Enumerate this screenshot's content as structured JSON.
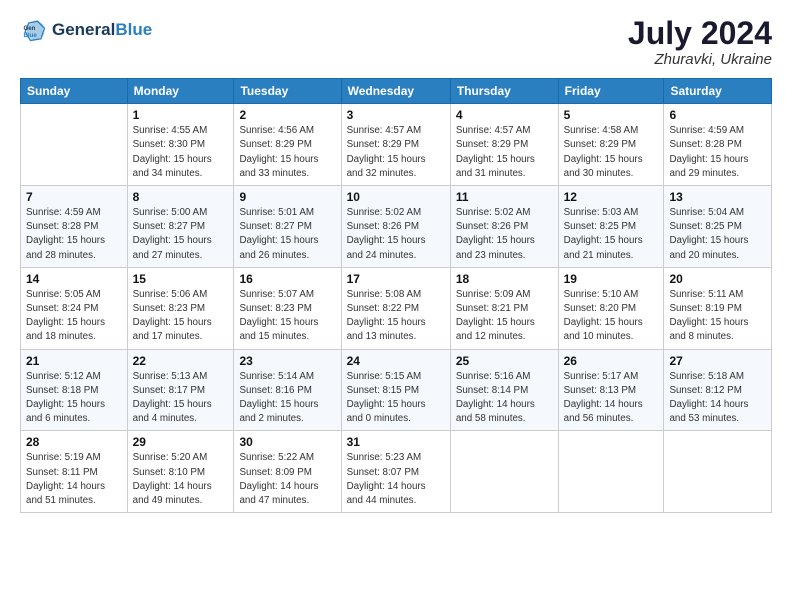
{
  "header": {
    "logo_line1": "General",
    "logo_line2": "Blue",
    "month_year": "July 2024",
    "location": "Zhuravki, Ukraine"
  },
  "days_of_week": [
    "Sunday",
    "Monday",
    "Tuesday",
    "Wednesday",
    "Thursday",
    "Friday",
    "Saturday"
  ],
  "weeks": [
    [
      {
        "day": "",
        "info": ""
      },
      {
        "day": "1",
        "info": "Sunrise: 4:55 AM\nSunset: 8:30 PM\nDaylight: 15 hours\nand 34 minutes."
      },
      {
        "day": "2",
        "info": "Sunrise: 4:56 AM\nSunset: 8:29 PM\nDaylight: 15 hours\nand 33 minutes."
      },
      {
        "day": "3",
        "info": "Sunrise: 4:57 AM\nSunset: 8:29 PM\nDaylight: 15 hours\nand 32 minutes."
      },
      {
        "day": "4",
        "info": "Sunrise: 4:57 AM\nSunset: 8:29 PM\nDaylight: 15 hours\nand 31 minutes."
      },
      {
        "day": "5",
        "info": "Sunrise: 4:58 AM\nSunset: 8:29 PM\nDaylight: 15 hours\nand 30 minutes."
      },
      {
        "day": "6",
        "info": "Sunrise: 4:59 AM\nSunset: 8:28 PM\nDaylight: 15 hours\nand 29 minutes."
      }
    ],
    [
      {
        "day": "7",
        "info": "Sunrise: 4:59 AM\nSunset: 8:28 PM\nDaylight: 15 hours\nand 28 minutes."
      },
      {
        "day": "8",
        "info": "Sunrise: 5:00 AM\nSunset: 8:27 PM\nDaylight: 15 hours\nand 27 minutes."
      },
      {
        "day": "9",
        "info": "Sunrise: 5:01 AM\nSunset: 8:27 PM\nDaylight: 15 hours\nand 26 minutes."
      },
      {
        "day": "10",
        "info": "Sunrise: 5:02 AM\nSunset: 8:26 PM\nDaylight: 15 hours\nand 24 minutes."
      },
      {
        "day": "11",
        "info": "Sunrise: 5:02 AM\nSunset: 8:26 PM\nDaylight: 15 hours\nand 23 minutes."
      },
      {
        "day": "12",
        "info": "Sunrise: 5:03 AM\nSunset: 8:25 PM\nDaylight: 15 hours\nand 21 minutes."
      },
      {
        "day": "13",
        "info": "Sunrise: 5:04 AM\nSunset: 8:25 PM\nDaylight: 15 hours\nand 20 minutes."
      }
    ],
    [
      {
        "day": "14",
        "info": "Sunrise: 5:05 AM\nSunset: 8:24 PM\nDaylight: 15 hours\nand 18 minutes."
      },
      {
        "day": "15",
        "info": "Sunrise: 5:06 AM\nSunset: 8:23 PM\nDaylight: 15 hours\nand 17 minutes."
      },
      {
        "day": "16",
        "info": "Sunrise: 5:07 AM\nSunset: 8:23 PM\nDaylight: 15 hours\nand 15 minutes."
      },
      {
        "day": "17",
        "info": "Sunrise: 5:08 AM\nSunset: 8:22 PM\nDaylight: 15 hours\nand 13 minutes."
      },
      {
        "day": "18",
        "info": "Sunrise: 5:09 AM\nSunset: 8:21 PM\nDaylight: 15 hours\nand 12 minutes."
      },
      {
        "day": "19",
        "info": "Sunrise: 5:10 AM\nSunset: 8:20 PM\nDaylight: 15 hours\nand 10 minutes."
      },
      {
        "day": "20",
        "info": "Sunrise: 5:11 AM\nSunset: 8:19 PM\nDaylight: 15 hours\nand 8 minutes."
      }
    ],
    [
      {
        "day": "21",
        "info": "Sunrise: 5:12 AM\nSunset: 8:18 PM\nDaylight: 15 hours\nand 6 minutes."
      },
      {
        "day": "22",
        "info": "Sunrise: 5:13 AM\nSunset: 8:17 PM\nDaylight: 15 hours\nand 4 minutes."
      },
      {
        "day": "23",
        "info": "Sunrise: 5:14 AM\nSunset: 8:16 PM\nDaylight: 15 hours\nand 2 minutes."
      },
      {
        "day": "24",
        "info": "Sunrise: 5:15 AM\nSunset: 8:15 PM\nDaylight: 15 hours\nand 0 minutes."
      },
      {
        "day": "25",
        "info": "Sunrise: 5:16 AM\nSunset: 8:14 PM\nDaylight: 14 hours\nand 58 minutes."
      },
      {
        "day": "26",
        "info": "Sunrise: 5:17 AM\nSunset: 8:13 PM\nDaylight: 14 hours\nand 56 minutes."
      },
      {
        "day": "27",
        "info": "Sunrise: 5:18 AM\nSunset: 8:12 PM\nDaylight: 14 hours\nand 53 minutes."
      }
    ],
    [
      {
        "day": "28",
        "info": "Sunrise: 5:19 AM\nSunset: 8:11 PM\nDaylight: 14 hours\nand 51 minutes."
      },
      {
        "day": "29",
        "info": "Sunrise: 5:20 AM\nSunset: 8:10 PM\nDaylight: 14 hours\nand 49 minutes."
      },
      {
        "day": "30",
        "info": "Sunrise: 5:22 AM\nSunset: 8:09 PM\nDaylight: 14 hours\nand 47 minutes."
      },
      {
        "day": "31",
        "info": "Sunrise: 5:23 AM\nSunset: 8:07 PM\nDaylight: 14 hours\nand 44 minutes."
      },
      {
        "day": "",
        "info": ""
      },
      {
        "day": "",
        "info": ""
      },
      {
        "day": "",
        "info": ""
      }
    ]
  ]
}
